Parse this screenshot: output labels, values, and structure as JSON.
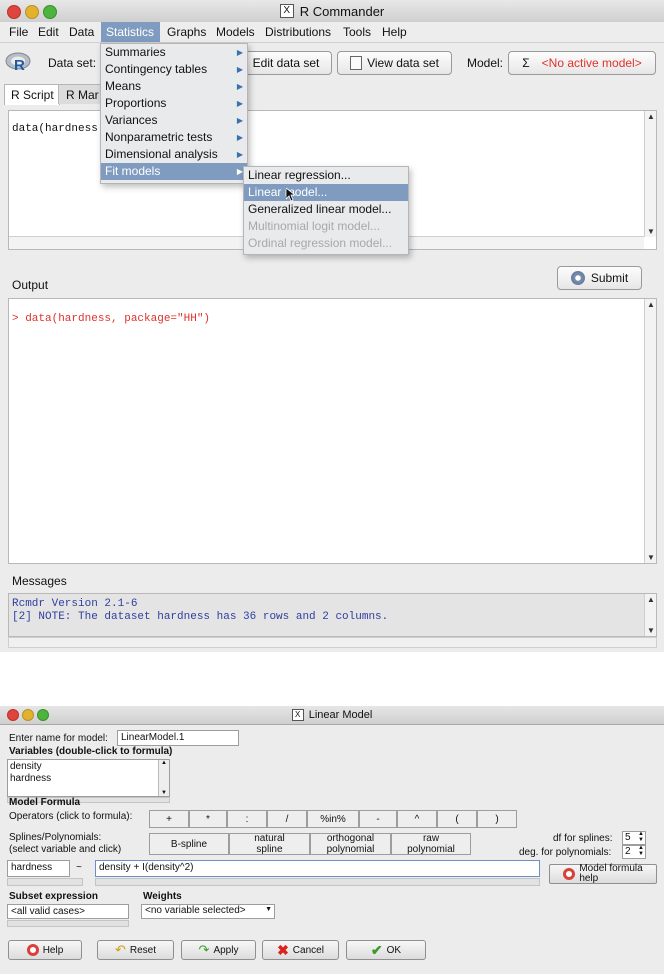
{
  "rcmdr": {
    "window_title": "R Commander",
    "menubar": [
      "File",
      "Edit",
      "Data",
      "Statistics",
      "Graphs",
      "Models",
      "Distributions",
      "Tools",
      "Help"
    ],
    "toolbar": {
      "dataset_label": "Data set:",
      "edit_dataset": "Edit data set",
      "view_dataset": "View data set",
      "model_label": "Model:",
      "model_sigma": "Σ",
      "model_value": "<No active model>"
    },
    "tabs": [
      "R Script",
      "R Mar"
    ],
    "script_text": "data(hardness",
    "output_label": "Output",
    "submit": "Submit",
    "output_text": "> data(hardness, package=\"HH\")",
    "messages_label": "Messages",
    "messages": [
      "Rcmdr Version 2.1-6",
      "[2] NOTE: The dataset hardness has 36 rows and 2 columns."
    ],
    "statistics_menu": [
      "Summaries",
      "Contingency tables",
      "Means",
      "Proportions",
      "Variances",
      "Nonparametric tests",
      "Dimensional analysis",
      "Fit models"
    ],
    "fit_models_menu": [
      "Linear regression...",
      "Linear model...",
      "Generalized linear model...",
      "Multinomial logit model...",
      "Ordinal regression model..."
    ]
  },
  "lm": {
    "window_title": "Linear Model",
    "name_label": "Enter name for model:",
    "name_value": "LinearModel.1",
    "variables_heading": "Variables (double-click to formula)",
    "variables": [
      "density",
      "hardness"
    ],
    "formula_heading": "Model Formula",
    "operators_label": "Operators (click to formula):",
    "operators": [
      "+",
      "*",
      ":",
      "/",
      "%in%",
      "-",
      "^",
      "(",
      ")"
    ],
    "splines_label": [
      "Splines/Polynomials:",
      "(select variable and click)"
    ],
    "spline_buttons": [
      [
        "B-spline",
        ""
      ],
      [
        "natural",
        "spline"
      ],
      [
        "orthogonal",
        "polynomial"
      ],
      [
        "raw",
        "polynomial"
      ]
    ],
    "df_splines_label": "df for splines:",
    "df_splines_value": "5",
    "deg_poly_label": "deg. for polynomials:",
    "deg_poly_value": "2",
    "lhs_value": "hardness",
    "tilde": "~",
    "rhs_value": "density + I(density^2)",
    "formula_help": [
      "Model formula",
      "help"
    ],
    "subset_heading": "Subset expression",
    "subset_value": "<all valid cases>",
    "weights_heading": "Weights",
    "weights_value": "<no variable selected>",
    "buttons": {
      "help": "Help",
      "reset": "Reset",
      "apply": "Apply",
      "cancel": "Cancel",
      "ok": "OK"
    }
  },
  "colors": {
    "accent_red": "#e0322a",
    "menu_highlight": "#7f9cc0",
    "mono_blue": "#2f3f9f"
  }
}
